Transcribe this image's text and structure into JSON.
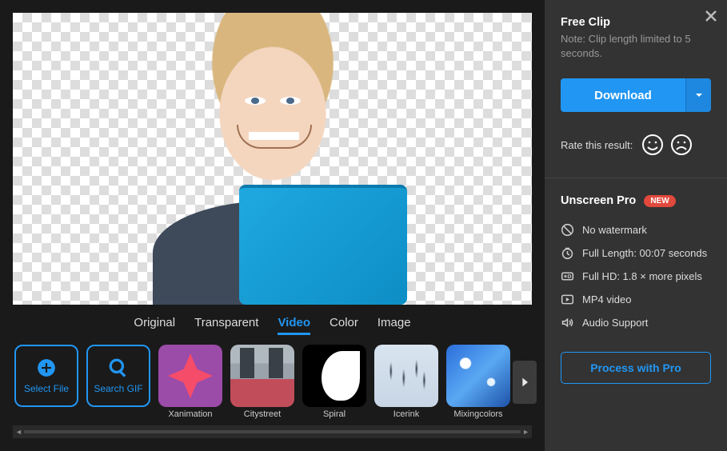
{
  "tabs": {
    "original": "Original",
    "transparent": "Transparent",
    "video": "Video",
    "color": "Color",
    "image": "Image"
  },
  "tools": {
    "select_file": "Select File",
    "search_gif": "Search GIF"
  },
  "thumbs": {
    "xanimation": "Xanimation",
    "citystreet": "Citystreet",
    "spiral": "Spiral",
    "icerink": "Icerink",
    "mixingcolors": "Mixingcolors"
  },
  "sidebar": {
    "free_clip_title": "Free Clip",
    "free_clip_note": "Note: Clip length limited to 5 seconds.",
    "download": "Download",
    "rate_label": "Rate this result:",
    "pro_title": "Unscreen Pro",
    "badge": "NEW",
    "features": {
      "no_watermark": "No watermark",
      "full_length": "Full Length: 00:07 seconds",
      "full_hd": "Full HD: 1.8 × more pixels",
      "mp4": "MP4 video",
      "audio": "Audio Support"
    },
    "process": "Process with Pro"
  }
}
